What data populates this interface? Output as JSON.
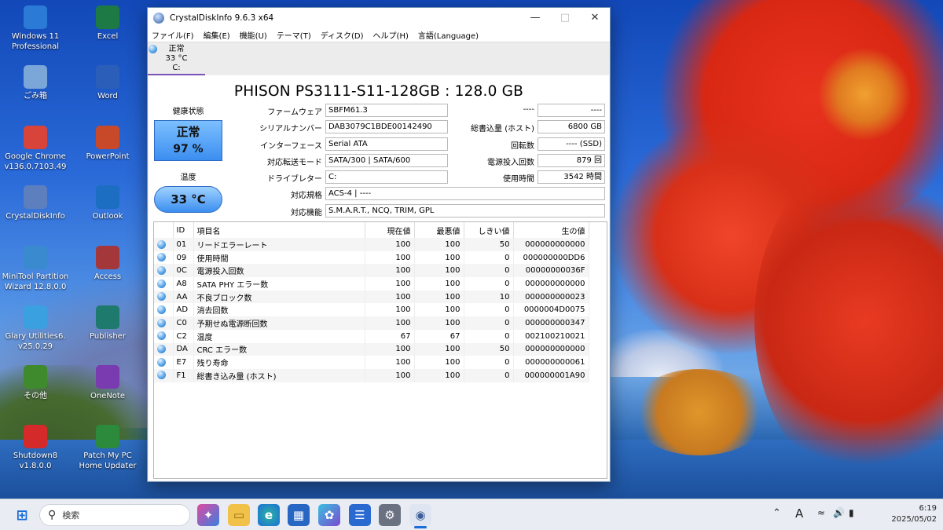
{
  "desktop": {
    "icons": [
      {
        "label": "Windows 11\nProfessional",
        "icon": "windows-icon",
        "color": "#2a7ad6"
      },
      {
        "label": "Excel",
        "icon": "excel-icon",
        "color": "#1e7a45"
      },
      {
        "label": "ごみ箱",
        "icon": "recycle-bin-icon",
        "color": "#7aa6d8"
      },
      {
        "label": "Word",
        "icon": "word-icon",
        "color": "#2b5eb8"
      },
      {
        "label": "Google Chrome\nv136.0.7103.49",
        "icon": "chrome-icon",
        "color": "#d8433a"
      },
      {
        "label": "PowerPoint",
        "icon": "powerpoint-icon",
        "color": "#c7492a"
      },
      {
        "label": "CrystalDiskInfo",
        "icon": "crystaldiskinfo-icon",
        "color": "#5d7fbd"
      },
      {
        "label": "Outlook",
        "icon": "outlook-icon",
        "color": "#1b6ec2"
      },
      {
        "label": "MiniTool Partition\nWizard 12.8.0.0",
        "icon": "minitool-icon",
        "color": "#3a8ad0"
      },
      {
        "label": "Access",
        "icon": "access-icon",
        "color": "#a4373a"
      },
      {
        "label": "Glary Utilities6.\nv25.0.29",
        "icon": "glary-icon",
        "color": "#3aa0e0"
      },
      {
        "label": "Publisher",
        "icon": "publisher-icon",
        "color": "#1f7a6e"
      },
      {
        "label": "その他",
        "icon": "tree-icon",
        "color": "#3f8a2c"
      },
      {
        "label": "OneNote",
        "icon": "onenote-icon",
        "color": "#7a3bb0"
      },
      {
        "label": "Shutdown8\nv1.8.0.0",
        "icon": "power-icon",
        "color": "#d42a2a"
      },
      {
        "label": "Patch My PC\nHome Updater",
        "icon": "patchmypc-icon",
        "color": "#2c8a3c"
      }
    ]
  },
  "window": {
    "title": "CrystalDiskInfo 9.6.3 x64",
    "menu": [
      "ファイル(F)",
      "編集(E)",
      "機能(U)",
      "テーマ(T)",
      "ディスク(D)",
      "ヘルプ(H)",
      "言語(Language)"
    ],
    "disk_tab": {
      "status": "正常",
      "temp": "33 °C",
      "drive": "C:"
    },
    "model": "PHISON PS3111-S11-128GB : 128.0 GB",
    "health_label": "健康状態",
    "health_status": "正常",
    "health_percent": "97 %",
    "temp_label": "温度",
    "temp_value": "33 °C",
    "info": {
      "firmware_label": "ファームウェア",
      "firmware": "SBFM61.3",
      "serial_label": "シリアルナンバー",
      "serial": "DAB3079C1BDE00142490",
      "interface_label": "インターフェース",
      "interface": "Serial ATA",
      "transfer_label": "対応転送モード",
      "transfer": "SATA/300 | SATA/600",
      "drive_label": "ドライブレター",
      "drive": "C:",
      "standard_label": "対応規格",
      "standard": "ACS-4 | ----",
      "features_label": "対応機能",
      "features": "S.M.A.R.T., NCQ, TRIM, GPL",
      "blank_label": "----",
      "blank_value": "----",
      "host_writes_label": "総書込量 (ホスト)",
      "host_writes": "6800 GB",
      "rotation_label": "回転数",
      "rotation": "---- (SSD)",
      "power_count_label": "電源投入回数",
      "power_count": "879 回",
      "power_hours_label": "使用時間",
      "power_hours": "3542 時間"
    },
    "smart": {
      "headers": [
        "",
        "ID",
        "項目名",
        "現在値",
        "最悪値",
        "しきい値",
        "生の値"
      ],
      "rows": [
        [
          "01",
          "リードエラーレート",
          "100",
          "100",
          "50",
          "000000000000"
        ],
        [
          "09",
          "使用時間",
          "100",
          "100",
          "0",
          "000000000DD6"
        ],
        [
          "0C",
          "電源投入回数",
          "100",
          "100",
          "0",
          "00000000036F"
        ],
        [
          "A8",
          "SATA PHY エラー数",
          "100",
          "100",
          "0",
          "000000000000"
        ],
        [
          "AA",
          "不良ブロック数",
          "100",
          "100",
          "10",
          "000000000023"
        ],
        [
          "AD",
          "消去回数",
          "100",
          "100",
          "0",
          "0000004D0075"
        ],
        [
          "C0",
          "予期せぬ電源断回数",
          "100",
          "100",
          "0",
          "000000000347"
        ],
        [
          "C2",
          "温度",
          "67",
          "67",
          "0",
          "002100210021"
        ],
        [
          "DA",
          "CRC エラー数",
          "100",
          "100",
          "50",
          "000000000000"
        ],
        [
          "E7",
          "残り寿命",
          "100",
          "100",
          "0",
          "000000000061"
        ],
        [
          "F1",
          "総書き込み量 (ホスト)",
          "100",
          "100",
          "0",
          "000000001A90"
        ]
      ]
    }
  },
  "taskbar": {
    "search_placeholder": "検索",
    "ime": "A",
    "time": "6:19",
    "date": "2025/05/02",
    "accent": "#1a6ed8"
  }
}
